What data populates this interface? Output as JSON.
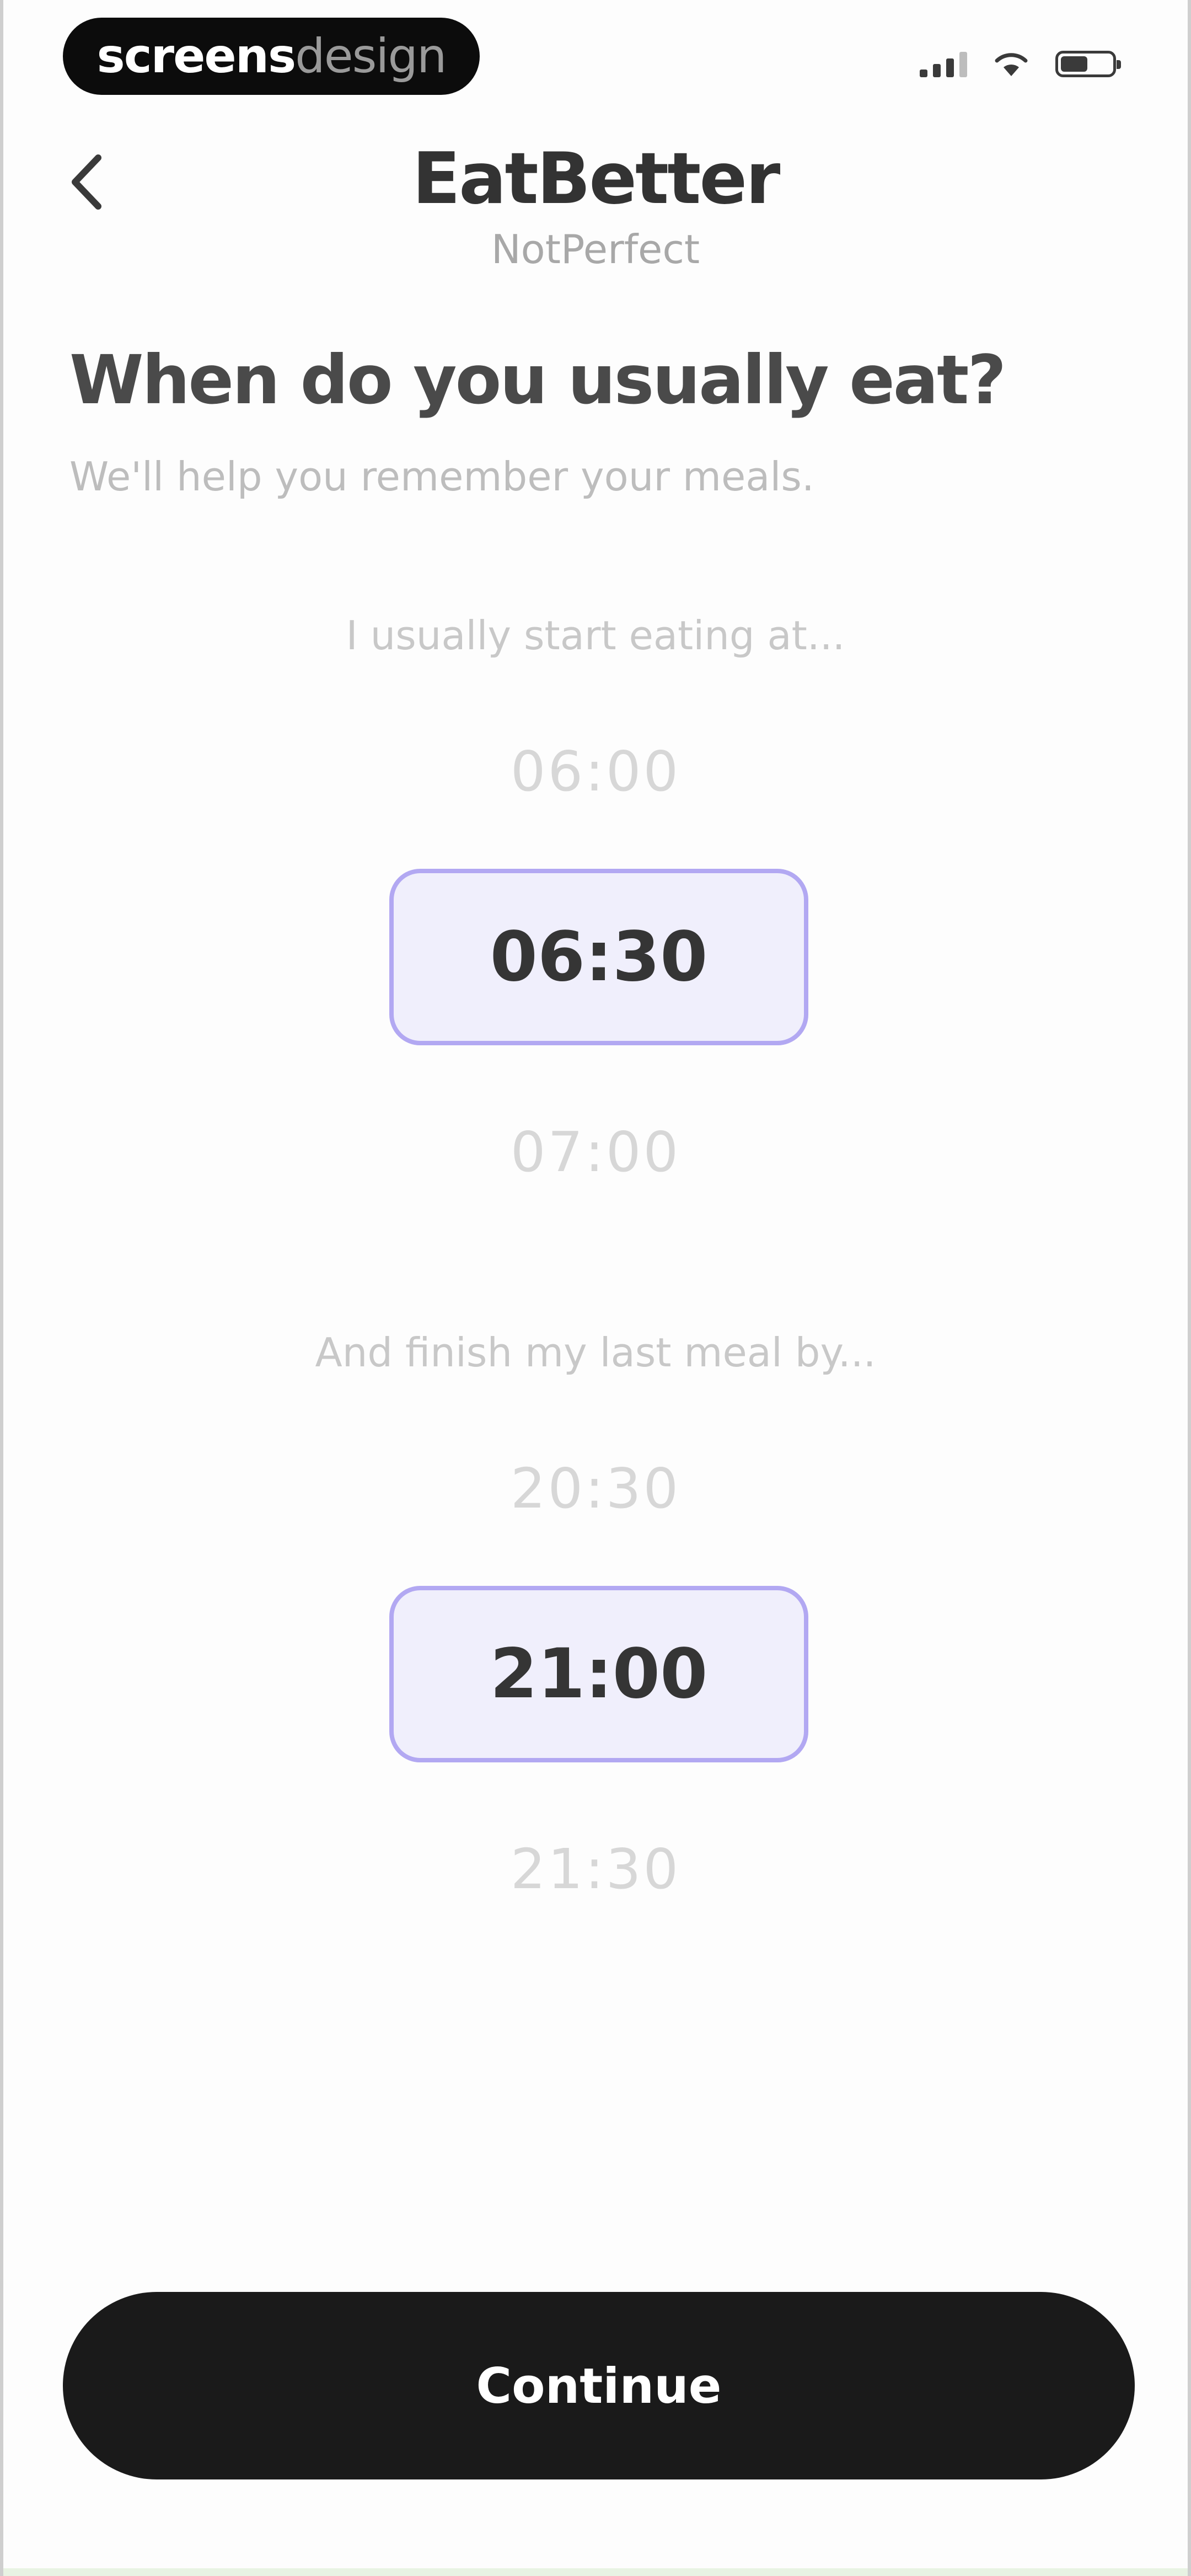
{
  "status_bar": {
    "brand_bold": "screens",
    "brand_light": "design",
    "icons": [
      "signal-icon",
      "wifi-icon",
      "battery-icon"
    ]
  },
  "header": {
    "back_icon": "chevron-left-icon",
    "title": "EatBetter",
    "subtitle": "NotPerfect"
  },
  "content": {
    "question": "When do you usually eat?",
    "helper": "We'll help you remember your meals."
  },
  "start_picker": {
    "label": "I usually start eating at...",
    "above": "06:00",
    "selected": "06:30",
    "below": "07:00"
  },
  "end_picker": {
    "label": "And finish my last meal by...",
    "above": "20:30",
    "selected": "21:00",
    "below": "21:30"
  },
  "footer": {
    "continue_label": "Continue"
  },
  "colors": {
    "accent_border": "#b2a8f2",
    "accent_fill": "#f0effc",
    "button": "#1a1a1a"
  }
}
